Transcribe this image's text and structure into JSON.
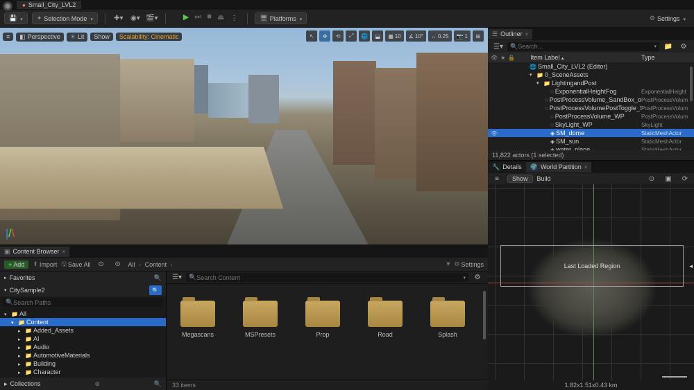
{
  "titlebar": {
    "doc_name": "Small_City_LVL2"
  },
  "main_toolbar": {
    "selection_mode": "Selection Mode",
    "platforms": "Platforms",
    "settings": "Settings"
  },
  "viewport_toolbar": {
    "perspective": "Perspective",
    "lit": "Lit",
    "show": "Show",
    "scalability": "Scalability: Cinematic",
    "grid_snap": "10",
    "angle_snap": "10°",
    "scale_snap": "0.25",
    "speed": "1"
  },
  "outliner": {
    "tab": "Outliner",
    "search_placeholder": "Search...",
    "header_item": "Item Label",
    "header_type": "Type",
    "rows": [
      {
        "indent": 36,
        "name": "Small_City_LVL2 (Editor)",
        "type": "",
        "icon": "🌐"
      },
      {
        "indent": 46,
        "name": "0_SceneAssets",
        "type": "",
        "icon": "📁",
        "open": true
      },
      {
        "indent": 56,
        "name": "LightingandPost",
        "type": "",
        "icon": "📁",
        "open": true
      },
      {
        "indent": 66,
        "name": "ExponentialHeightFog",
        "type": "ExponentialHeight",
        "icon": "◌"
      },
      {
        "indent": 66,
        "name": "PostProcessVolume_SandBox_only",
        "type": "PostProcessVolum",
        "icon": "◌"
      },
      {
        "indent": 66,
        "name": "PostProcessVolumePostToggle_S",
        "type": "PostProcessVolum",
        "icon": "◌"
      },
      {
        "indent": 66,
        "name": "PostProcessVolume_WP",
        "type": "PostProcessVolum",
        "icon": "◌"
      },
      {
        "indent": 66,
        "name": "SkyLight_WP",
        "type": "SkyLight",
        "icon": "◌"
      },
      {
        "indent": 66,
        "name": "SM_dome",
        "type": "StaticMeshActor",
        "icon": "◈",
        "selected": true,
        "eye": true
      },
      {
        "indent": 66,
        "name": "SM_sun",
        "type": "StaticMeshActor",
        "icon": "◈"
      },
      {
        "indent": 66,
        "name": "water_plane",
        "type": "StaticMeshActor",
        "icon": "◈"
      }
    ],
    "status": "11,822 actors (1 selected)"
  },
  "details_tab": "Details",
  "world_partition": {
    "tab": "World Partition",
    "show": "Show",
    "build": "Build",
    "region_label": "Last Loaded Region",
    "scale": "1.82x1.51x0.43 km"
  },
  "content_browser": {
    "tab": "Content Browser",
    "add": "Add",
    "import": "Import",
    "save_all": "Save All",
    "breadcrumb": {
      "root": "All",
      "current": "Content"
    },
    "settings": "Settings",
    "favorites": "Favorites",
    "project": "CitySample2",
    "search_paths_placeholder": "Search Paths",
    "search_content_placeholder": "Search Content",
    "tree": [
      {
        "indent": 2,
        "label": "All",
        "open": true,
        "folder": true
      },
      {
        "indent": 12,
        "label": "Content",
        "open": true,
        "folder": true,
        "selected": true
      },
      {
        "indent": 22,
        "label": "Added_Assets",
        "folder": true
      },
      {
        "indent": 22,
        "label": "AI",
        "folder": true
      },
      {
        "indent": 22,
        "label": "Audio",
        "folder": true
      },
      {
        "indent": 22,
        "label": "AutomotiveMaterials",
        "folder": true
      },
      {
        "indent": 22,
        "label": "Building",
        "folder": true
      },
      {
        "indent": 22,
        "label": "Character",
        "folder": true
      }
    ],
    "collections": "Collections",
    "folders": [
      "Megascans",
      "MSPresets",
      "Prop",
      "Road",
      "Splash"
    ],
    "status": "33 items"
  }
}
